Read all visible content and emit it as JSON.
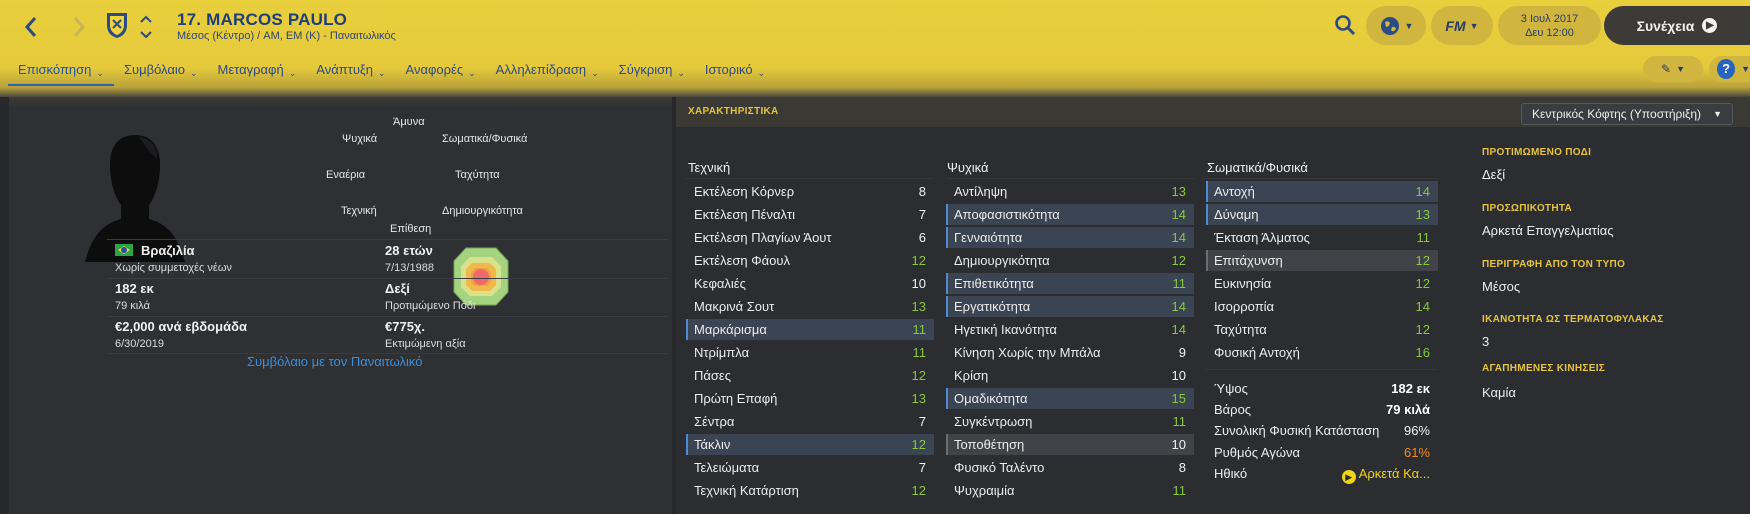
{
  "header": {
    "title": "17. MARCOS PAULO",
    "subtitle": "Μέσος (Κέντρο) / AM, EM (Κ) - Παναιτωλικός",
    "date": "3 Ιουλ 2017",
    "time": "Δευ 12:00",
    "continue_label": "Συνέχεια",
    "fm_label": "FM",
    "accent_color": "#e9cf3c",
    "nav_color": "#2b4a86"
  },
  "tabs": [
    {
      "label": "Επισκόπηση"
    },
    {
      "label": "Συμβόλαιο"
    },
    {
      "label": "Μεταγραφή"
    },
    {
      "label": "Ανάπτυξη"
    },
    {
      "label": "Αναφορές"
    },
    {
      "label": "Αλληλεπίδραση"
    },
    {
      "label": "Σύγκριση"
    },
    {
      "label": "Ιστορικό"
    }
  ],
  "profile": {
    "nationality": "Βραζιλία",
    "youth": "Χωρίς συμμετοχές νέων",
    "height": "182 εκ",
    "weight": "79 κιλά",
    "wage": "€2,000 ανά εβδομάδα",
    "contract_end": "6/30/2019",
    "age": "28 ετών",
    "dob": "7/13/1988",
    "foot": "Δεξί",
    "foot_label": "Προτιμώμενο Πόδι",
    "value": "€775χ.",
    "value_label": "Εκτιμώμενη αξία",
    "contract_link": "Συμβόλαιο με τον Παναιτωλικό"
  },
  "radar": {
    "labels": {
      "top": "Άμυνα",
      "top_right": "Σωματικά/Φυσικά",
      "right": "Ταχύτητα",
      "bottom_right": "Δημιουργικότητα",
      "bottom": "Επίθεση",
      "bottom_left": "Τεχνική",
      "left": "Εναέρια",
      "top_left": "Ψυχικά"
    }
  },
  "attributes": {
    "title": "ΧΑΡΑΚΤΗΡΙΣΤΙΚΑ",
    "role_select": "Κεντρικός Κόφτης (Υποστήριξη)",
    "technical": {
      "header": "Τεχνική",
      "items": [
        {
          "name": "Εκτέλεση Κόρνερ",
          "value": "8"
        },
        {
          "name": "Εκτέλεση Πέναλτι",
          "value": "7"
        },
        {
          "name": "Εκτέλεση Πλαγίων Άουτ",
          "value": "6"
        },
        {
          "name": "Εκτέλεση Φάουλ",
          "value": "12"
        },
        {
          "name": "Κεφαλιές",
          "value": "10"
        },
        {
          "name": "Μακρινά Σουτ",
          "value": "13"
        },
        {
          "name": "Μαρκάρισμα",
          "value": "11"
        },
        {
          "name": "Ντρίμπλα",
          "value": "11"
        },
        {
          "name": "Πάσες",
          "value": "12"
        },
        {
          "name": "Πρώτη Επαφή",
          "value": "13"
        },
        {
          "name": "Σέντρα",
          "value": "7"
        },
        {
          "name": "Τάκλιν",
          "value": "12"
        },
        {
          "name": "Τελειώματα",
          "value": "7"
        },
        {
          "name": "Τεχνική Κατάρτιση",
          "value": "12"
        }
      ]
    },
    "mental": {
      "header": "Ψυχικά",
      "items": [
        {
          "name": "Αντίληψη",
          "value": "13"
        },
        {
          "name": "Αποφασιστικότητα",
          "value": "14"
        },
        {
          "name": "Γενναιότητα",
          "value": "14"
        },
        {
          "name": "Δημιουργικότητα",
          "value": "12"
        },
        {
          "name": "Επιθετικότητα",
          "value": "11"
        },
        {
          "name": "Εργατικότητα",
          "value": "14"
        },
        {
          "name": "Ηγετική Ικανότητα",
          "value": "14"
        },
        {
          "name": "Κίνηση Χωρίς την Μπάλα",
          "value": "9"
        },
        {
          "name": "Κρίση",
          "value": "10"
        },
        {
          "name": "Ομαδικότητα",
          "value": "15"
        },
        {
          "name": "Συγκέντρωση",
          "value": "11"
        },
        {
          "name": "Τοποθέτηση",
          "value": "10"
        },
        {
          "name": "Φυσικό Ταλέντο",
          "value": "8"
        },
        {
          "name": "Ψυχραιμία",
          "value": "11"
        }
      ]
    },
    "physical": {
      "header": "Σωματικά/Φυσικά",
      "items": [
        {
          "name": "Αντοχή",
          "value": "14"
        },
        {
          "name": "Δύναμη",
          "value": "13"
        },
        {
          "name": "Έκταση Άλματος",
          "value": "11"
        },
        {
          "name": "Επιτάχυνση",
          "value": "12"
        },
        {
          "name": "Ευκινησία",
          "value": "12"
        },
        {
          "name": "Ισορροπία",
          "value": "14"
        },
        {
          "name": "Ταχύτητα",
          "value": "12"
        },
        {
          "name": "Φυσική Αντοχή",
          "value": "16"
        }
      ]
    },
    "condition": {
      "height_label": "Ύψος",
      "height_value": "182 εκ",
      "weight_label": "Βάρος",
      "weight_value": "79 κιλά",
      "fitness_label": "Συνολική Φυσική Κατάσταση",
      "fitness_value": "96%",
      "sharpness_label": "Ρυθμός Αγώνα",
      "sharpness_value": "61%",
      "morale_label": "Ηθικό",
      "morale_value": "Αρκετά Κα..."
    }
  },
  "info": {
    "foot_title": "ΠΡΟΤΙΜΩΜΕΝΟ ΠΟΔΙ",
    "foot_value": "Δεξί",
    "personality_title": "ΠΡΟΣΩΠΙΚΟΤΗΤΑ",
    "personality_value": "Αρκετά Επαγγελματίας",
    "media_title": "ΠΕΡΙΓΡΑΦΗ ΑΠΟ ΤΟΝ ΤΥΠΟ",
    "media_value": "Μέσος",
    "gk_title": "ΙΚΑΝΟΤΗΤΑ ΩΣ ΤΕΡΜΑΤΟΦΥΛΑΚΑΣ",
    "gk_value": "3",
    "moves_title": "ΑΓΑΠΗΜΕΝΕΣ ΚΙΝΗΣΕΙΣ",
    "moves_value": "Καμία"
  }
}
